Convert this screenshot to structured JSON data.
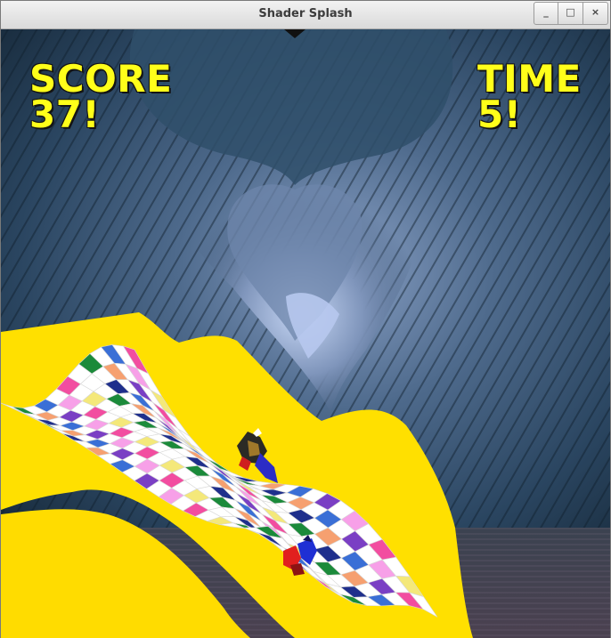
{
  "window": {
    "title": "Shader Splash",
    "buttons": {
      "minimize_glyph": "_",
      "maximize_glyph": "□",
      "close_glyph": "×"
    }
  },
  "hud": {
    "score_label": "SCORE",
    "score_value": "37!",
    "time_label": "TIME",
    "time_value": "5!"
  },
  "colors": {
    "hud_text": "#ffff1a",
    "track_edge": "#ffe000",
    "sky_dark": "#1e3348",
    "sky_light": "#9fb4d9"
  },
  "track": {
    "tile_colors": [
      "#ffffff",
      "#3a6fd6",
      "#f7a0e8",
      "#f4e87a",
      "#1b8a3a",
      "#f6a070",
      "#7a3fc4",
      "#f24da0",
      "#ffffff",
      "#1f2f8c"
    ]
  }
}
